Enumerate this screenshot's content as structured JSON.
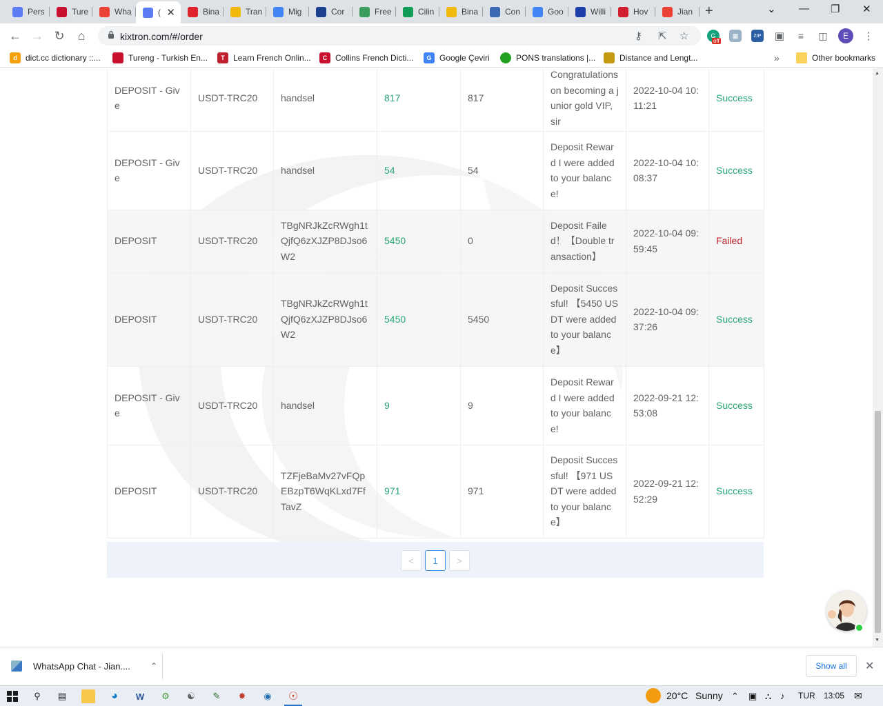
{
  "browser": {
    "tabs": [
      {
        "title": "Pers",
        "icon": "diamond-icon",
        "color": "#5b7cf5",
        "active": false
      },
      {
        "title": "Ture",
        "icon": "tureng-icon",
        "color": "#c8102e",
        "active": false
      },
      {
        "title": "Wha",
        "icon": "gmail-icon",
        "color": "#ea4335",
        "active": false
      },
      {
        "title": "(",
        "icon": "diamond-icon",
        "color": "#5b7cf5",
        "active": true
      },
      {
        "title": "Bina",
        "icon": "opera-icon",
        "color": "#e0242e",
        "active": false
      },
      {
        "title": "Tran",
        "icon": "binance-icon",
        "color": "#f0b90b",
        "active": false
      },
      {
        "title": "Mig",
        "icon": "google-icon",
        "color": "#4285f4",
        "active": false
      },
      {
        "title": "Cor",
        "icon": "ifas-icon",
        "color": "#1c3f8f",
        "active": false
      },
      {
        "title": "Free",
        "icon": "money-icon",
        "color": "#3a9d5d",
        "active": false
      },
      {
        "title": "Cilin",
        "icon": "sheets-icon",
        "color": "#0f9d58",
        "active": false
      },
      {
        "title": "Bina",
        "icon": "binance-icon",
        "color": "#f0b90b",
        "active": false
      },
      {
        "title": "Con",
        "icon": "user-icon",
        "color": "#3c6ab2",
        "active": false
      },
      {
        "title": "Goo",
        "icon": "translate-icon",
        "color": "#4285f4",
        "active": false
      },
      {
        "title": "Willi",
        "icon": "check-icon",
        "color": "#1c3faa",
        "active": false
      },
      {
        "title": "Hov",
        "icon": "merriam-icon",
        "color": "#d21f2f",
        "active": false
      },
      {
        "title": "Jian",
        "icon": "gmail-icon",
        "color": "#ea4335",
        "active": false
      }
    ],
    "url": "kixtron.com/#/order",
    "profile_initial": "E",
    "ext_badge": "off",
    "bookmarks": [
      {
        "label": "dict.cc dictionary ::...",
        "icon": "dictcc-icon",
        "color": "#f5a00d",
        "glyph": "d"
      },
      {
        "label": "Tureng - Turkish En...",
        "icon": "tureng-icon",
        "color": "#c8102e",
        "glyph": ""
      },
      {
        "label": "Learn French Onlin...",
        "icon": "french-icon",
        "color": "#bf1e2e",
        "glyph": "T"
      },
      {
        "label": "Collins French Dicti...",
        "icon": "collins-icon",
        "color": "#c8102e",
        "glyph": "C"
      },
      {
        "label": "Google Çeviri",
        "icon": "translate-icon",
        "color": "#4285f4",
        "glyph": "G"
      },
      {
        "label": "PONS translations |...",
        "icon": "pons-icon",
        "color": "#20a120",
        "glyph": ""
      },
      {
        "label": "Distance and Lengt...",
        "icon": "ruler-icon",
        "color": "#c49a10",
        "glyph": ""
      }
    ],
    "bookmarks_more": "»",
    "other_bookmarks": "Other bookmarks"
  },
  "orders": {
    "rows": [
      {
        "type": "DEPOSIT - Give",
        "currency": "USDT-TRC20",
        "address": "handsel",
        "amount": "817",
        "received": "817",
        "remark": "Congratulations on becoming a junior gold VIP, sir",
        "time": "2022-10-04 10:11:21",
        "status": "Success",
        "status_kind": "ok"
      },
      {
        "type": "DEPOSIT - Give",
        "currency": "USDT-TRC20",
        "address": "handsel",
        "amount": "54",
        "received": "54",
        "remark": "Deposit Reward I were added to your balance!",
        "time": "2022-10-04 10:08:37",
        "status": "Success",
        "status_kind": "ok"
      },
      {
        "type": "DEPOSIT",
        "currency": "USDT-TRC20",
        "address": "TBgNRJkZcRWgh1tQjfQ6zXJZP8DJso6W2",
        "amount": "5450",
        "received": "0",
        "remark": "Deposit Failed！【Double transaction】",
        "time": "2022-10-04 09:59:45",
        "status": "Failed",
        "status_kind": "fail"
      },
      {
        "type": "DEPOSIT",
        "currency": "USDT-TRC20",
        "address": "TBgNRJkZcRWgh1tQjfQ6zXJZP8DJso6W2",
        "amount": "5450",
        "received": "5450",
        "remark": "Deposit Successful! 【5450 USDT were added to your balance】",
        "time": "2022-10-04 09:37:26",
        "status": "Success",
        "status_kind": "ok"
      },
      {
        "type": "DEPOSIT - Give",
        "currency": "USDT-TRC20",
        "address": "handsel",
        "amount": "9",
        "received": "9",
        "remark": "Deposit Reward I were added to your balance!",
        "time": "2022-09-21 12:53:08",
        "status": "Success",
        "status_kind": "ok"
      },
      {
        "type": "DEPOSIT",
        "currency": "USDT-TRC20",
        "address": "TZFjeBaMv27vFQpEBzpT6WqKLxd7FfTavZ",
        "amount": "971",
        "received": "971",
        "remark": "Deposit Successful! 【971 USDT were added to your balance】",
        "time": "2022-09-21 12:52:29",
        "status": "Success",
        "status_kind": "ok"
      }
    ],
    "pagination": {
      "prev": "<",
      "current_page": "1",
      "next": ">"
    }
  },
  "download_shelf": {
    "item_label": "WhatsApp Chat - Jian....",
    "show_all": "Show all"
  },
  "taskbar": {
    "weather_temp": "20°C",
    "weather_text": "Sunny",
    "language": "TUR",
    "time": "13:05"
  }
}
